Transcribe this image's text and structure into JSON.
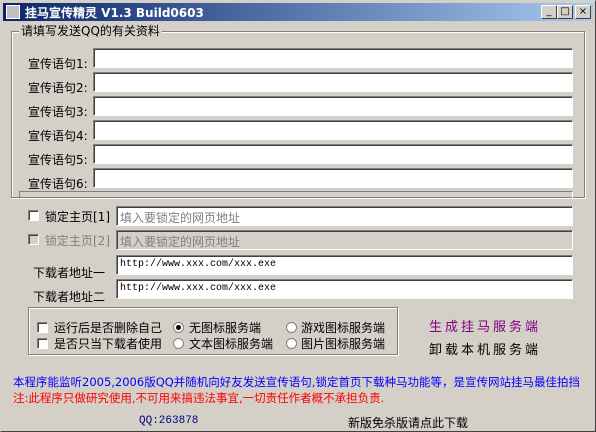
{
  "window": {
    "title": "挂马宣传精灵 V1.3 Build0603",
    "buttons": {
      "minimize": "_",
      "maximize": "□",
      "close": "×"
    }
  },
  "group": {
    "legend": "请填写发送QQ的有关资料",
    "slogans": [
      {
        "label": "宣传语句1:",
        "value": ""
      },
      {
        "label": "宣传语句2:",
        "value": ""
      },
      {
        "label": "宣传语句3:",
        "value": ""
      },
      {
        "label": "宣传语句4:",
        "value": ""
      },
      {
        "label": "宣传语句5:",
        "value": ""
      },
      {
        "label": "宣传语句6:",
        "value": ""
      }
    ]
  },
  "homepage": [
    {
      "label": "锁定主页[1]",
      "placeholder": "填入要锁定的网页地址",
      "checked": false,
      "enabled": true
    },
    {
      "label": "锁定主页[2]",
      "placeholder": "填入要锁定的网页地址",
      "checked": false,
      "enabled": false
    }
  ],
  "downloads": [
    {
      "label": "下载者地址一",
      "value": "http://www.xxx.com/xxx.exe"
    },
    {
      "label": "下载者地址二",
      "value": "http://www.xxx.com/xxx.exe"
    }
  ],
  "options": {
    "checkboxes": [
      {
        "label": "运行后是否删除自己",
        "checked": false
      },
      {
        "label": "是否只当下载者使用",
        "checked": false
      }
    ],
    "radios": [
      {
        "label": "无图标服务端",
        "checked": true
      },
      {
        "label": "游戏图标服务端",
        "checked": false
      },
      {
        "label": "文本图标服务端",
        "checked": false
      },
      {
        "label": "图片图标服务端",
        "checked": false
      }
    ]
  },
  "actions": {
    "generate": "生成挂马服务端",
    "uninstall": "卸载本机服务端"
  },
  "info": {
    "line1": "本程序能监听2005,2006版QQ并随机向好友发送宣传语句,锁定首页下载种马功能等，是宣传网站挂马最佳拍挡",
    "line2": "注:此程序只做研究使用,不可用来搞违法事宜,一切责任作者概不承担负责."
  },
  "status": {
    "qq": "QQ:263878",
    "download_link": "新版免杀版请点此下载"
  },
  "colors": {
    "face": "#d4d0c8",
    "title_start": "#0a246a",
    "title_end": "#a6caf0",
    "info_blue": "#0000ff",
    "info_red": "#ff0000",
    "generate_purple": "#800080",
    "qq_blue": "#000080"
  }
}
